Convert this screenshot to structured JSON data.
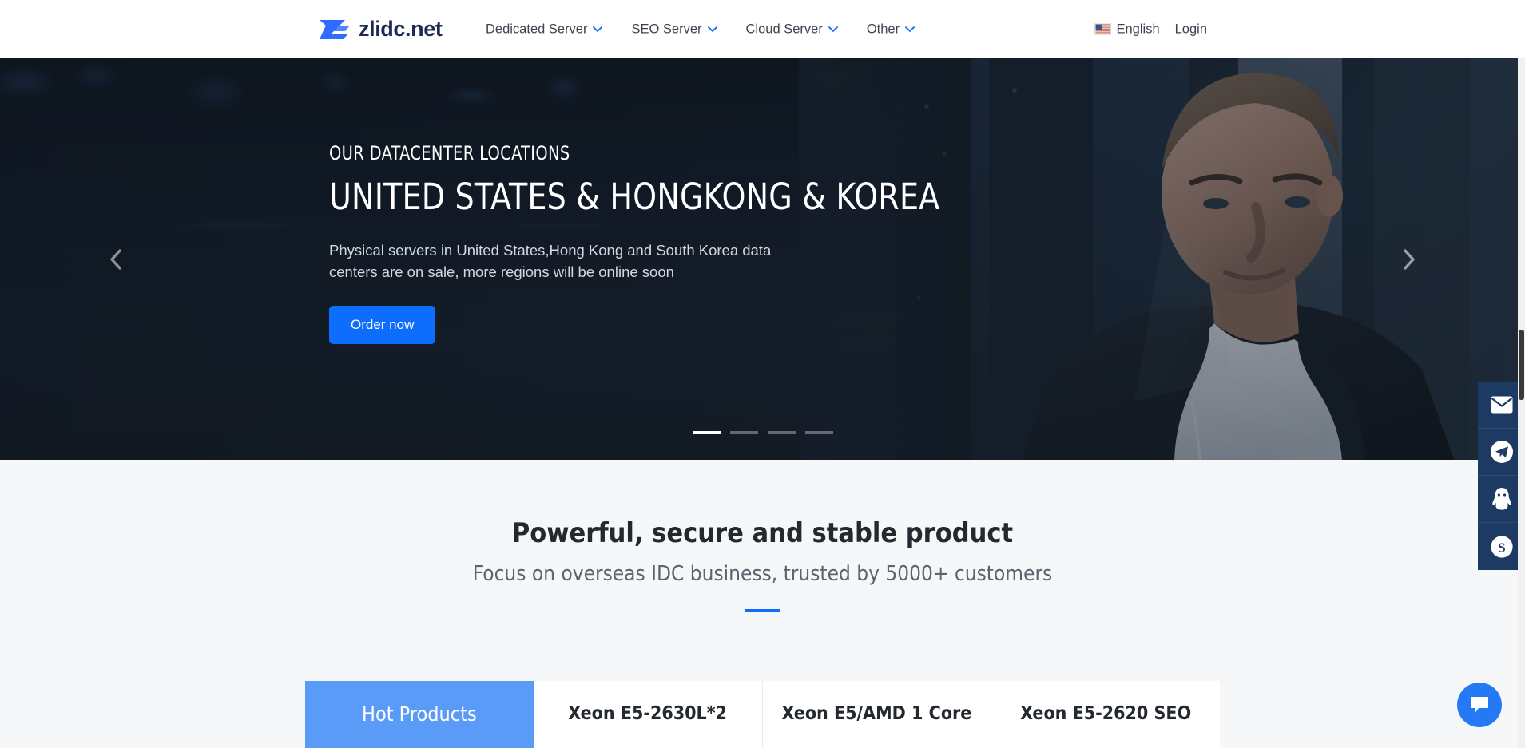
{
  "header": {
    "logo": {
      "text": "zlidc.net",
      "icon": "logo-z-mark",
      "color": "#2f6bff"
    },
    "nav": [
      {
        "label": "Dedicated Server",
        "caret": "chevron-down-icon"
      },
      {
        "label": "SEO Server",
        "caret": "chevron-down-icon"
      },
      {
        "label": "Cloud Server",
        "caret": "chevron-down-icon"
      },
      {
        "label": "Other",
        "caret": "chevron-down-icon"
      }
    ],
    "language": {
      "label": "English",
      "flag": "us-flag-icon"
    },
    "login": "Login"
  },
  "hero": {
    "eyebrow": "OUR DATACENTER LOCATIONS",
    "title": "UNITED STATES & HONGKONG & KOREA",
    "subtitle": "Physical servers in United States,Hong Kong and South Korea data centers are on sale, more regions will be online soon",
    "cta": "Order now",
    "prev_icon": "chevron-left-icon",
    "next_icon": "chevron-right-icon",
    "slides": 4,
    "active_slide": 1,
    "accent": "#0d6efd"
  },
  "section": {
    "title": "Powerful, secure and stable product",
    "subtitle": "Focus on overseas IDC business, trusted by 5000+ customers",
    "rule_color": "#0d6efd",
    "tabs": [
      {
        "label": "Hot Products",
        "active": true
      },
      {
        "label": "Xeon E5-2630L*2",
        "active": false
      },
      {
        "label": "Xeon E5/AMD 1 Core",
        "active": false
      },
      {
        "label": "Xeon E5-2620 SEO",
        "active": false
      }
    ]
  },
  "contact_rail": {
    "background": "#1d3a63",
    "items": [
      {
        "icon": "email-icon",
        "label": "Email"
      },
      {
        "icon": "telegram-icon",
        "label": "Telegram"
      },
      {
        "icon": "qq-icon",
        "label": "QQ"
      },
      {
        "icon": "skype-icon",
        "label": "Skype"
      }
    ]
  },
  "chat_fab": {
    "icon": "chat-bubble-icon",
    "color": "#2579f5"
  }
}
